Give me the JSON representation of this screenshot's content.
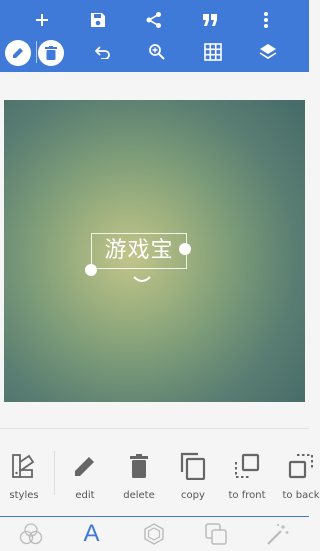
{
  "colors": {
    "primary": "#3f7ad8",
    "background": "#f5f5f5",
    "icon_dark": "#666666",
    "icon_light": "#bbbbbb"
  },
  "toolbar": {
    "top_row": [
      {
        "icon": "add-icon"
      },
      {
        "icon": "save-icon"
      },
      {
        "icon": "share-icon"
      },
      {
        "icon": "quote-icon"
      },
      {
        "icon": "more-vert-icon"
      }
    ],
    "second_row": [
      {
        "icon": "edit-icon"
      },
      {
        "icon": "delete-icon"
      },
      {
        "icon": "undo-icon"
      },
      {
        "icon": "zoom-in-icon"
      },
      {
        "icon": "grid-icon"
      },
      {
        "icon": "layers-icon"
      }
    ]
  },
  "canvas": {
    "text": "游戏宝"
  },
  "tools": [
    {
      "label": "styles",
      "icon": "styles-icon"
    },
    {
      "label": "edit",
      "icon": "pencil-icon"
    },
    {
      "label": "delete",
      "icon": "trash-icon"
    },
    {
      "label": "copy",
      "icon": "copy-icon"
    },
    {
      "label": "to front",
      "icon": "bring-front-icon"
    },
    {
      "label": "to back",
      "icon": "send-back-icon"
    }
  ],
  "tabs": [
    {
      "icon": "blend-icon",
      "active": false
    },
    {
      "icon": "text-icon",
      "active": true,
      "glyph": "A"
    },
    {
      "icon": "shape-icon",
      "active": false
    },
    {
      "icon": "overlay-icon",
      "active": false
    },
    {
      "icon": "magic-wand-icon",
      "active": false
    }
  ]
}
